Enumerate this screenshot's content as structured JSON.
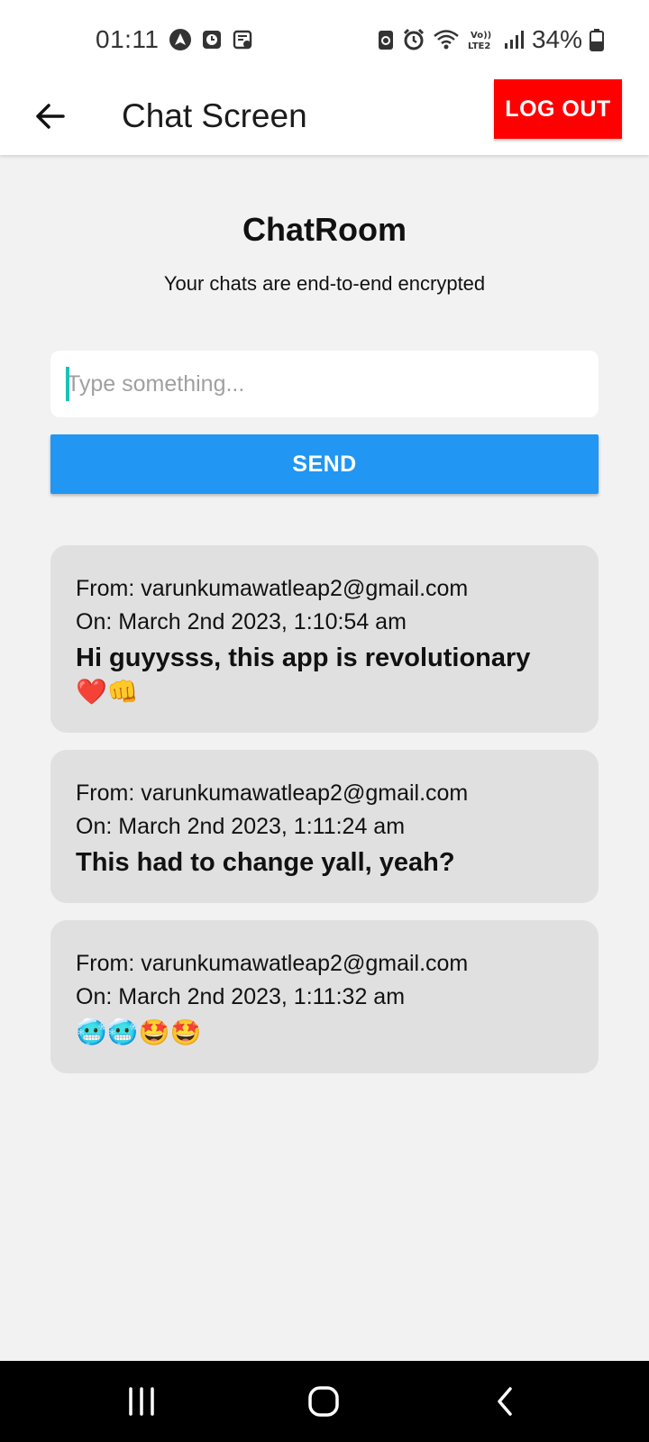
{
  "status_bar": {
    "time": "01:11",
    "battery_percent": "34%",
    "left_icons": [
      "navigation-app-icon",
      "clock-app-icon",
      "notes-app-icon"
    ],
    "right_icons": [
      "recycle-icon",
      "alarm-icon",
      "wifi-icon",
      "volte-icon",
      "signal-icon",
      "battery-icon"
    ]
  },
  "app_bar": {
    "title": "Chat Screen",
    "logout_label": "LOG OUT",
    "logout_color": "#ff0000"
  },
  "chat_room": {
    "title": "ChatRoom",
    "subtitle": "Your chats are end-to-end encrypted"
  },
  "composer": {
    "placeholder": "Type something...",
    "value": "",
    "send_label": "SEND",
    "send_color": "#2196f3"
  },
  "messages": [
    {
      "from": "From: varunkumawatleap2@gmail.com",
      "on": "On: March 2nd 2023, 1:10:54 am",
      "text": "Hi guyysss, this app is revolutionary",
      "emoji": "❤️👊"
    },
    {
      "from": "From: varunkumawatleap2@gmail.com",
      "on": "On: March 2nd 2023, 1:11:24 am",
      "text": "This had to change yall, yeah?",
      "emoji": ""
    },
    {
      "from": "From: varunkumawatleap2@gmail.com",
      "on": "On: March 2nd 2023, 1:11:32 am",
      "text": "",
      "emoji": "🥶🥶🤩🤩"
    }
  ],
  "nav_bar": {
    "icons": [
      "recent-apps-icon",
      "home-icon",
      "back-nav-icon"
    ]
  }
}
